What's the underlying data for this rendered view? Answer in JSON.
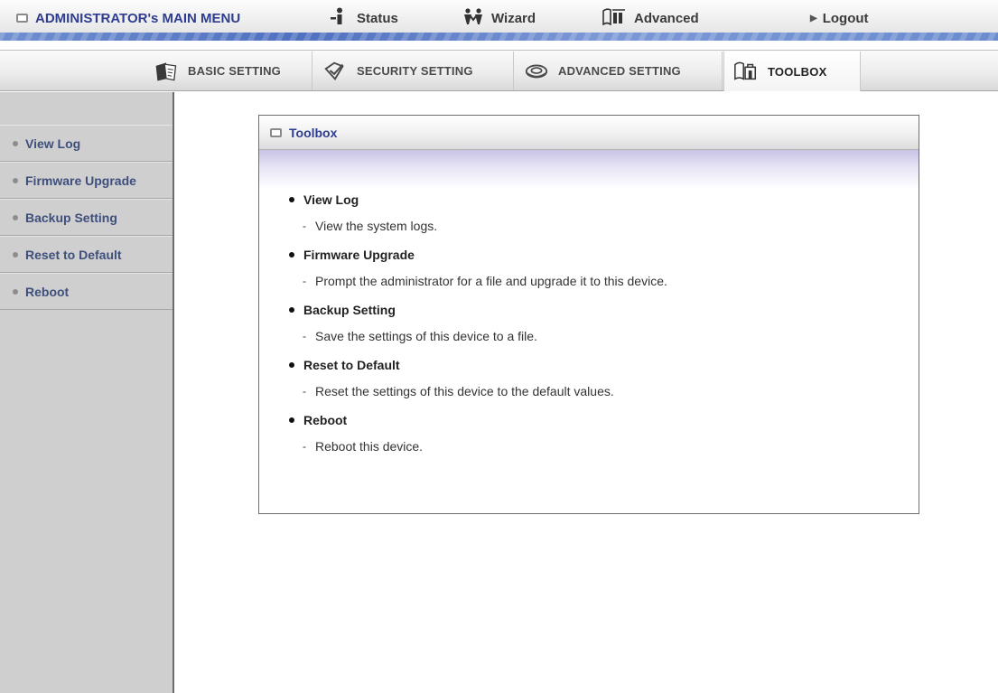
{
  "topbar": {
    "title": "ADMINISTRATOR's MAIN MENU",
    "nav": [
      {
        "label": "Status",
        "icon": "person-info-icon"
      },
      {
        "label": "Wizard",
        "icon": "wizard-people-icon"
      },
      {
        "label": "Advanced",
        "icon": "advanced-book-icon"
      },
      {
        "label": "Logout",
        "icon": "triangle-right-icon"
      }
    ]
  },
  "tabs": [
    {
      "label": "BASIC SETTING",
      "icon": "document-stack-icon"
    },
    {
      "label": "SECURITY SETTING",
      "icon": "shield-check-icon"
    },
    {
      "label": "ADVANCED SETTING",
      "icon": "gear-disc-icon"
    },
    {
      "label": "TOOLBOX",
      "icon": "toolbox-icon",
      "active": true
    }
  ],
  "sidebar": {
    "items": [
      {
        "label": "View Log"
      },
      {
        "label": "Firmware Upgrade"
      },
      {
        "label": "Backup Setting"
      },
      {
        "label": "Reset to Default"
      },
      {
        "label": "Reboot"
      }
    ]
  },
  "panel": {
    "title": "Toolbox",
    "items": [
      {
        "title": "View Log",
        "desc": "View the system logs."
      },
      {
        "title": "Firmware Upgrade",
        "desc": "Prompt the administrator for a file and upgrade it to this device."
      },
      {
        "title": "Backup Setting",
        "desc": "Save the settings of this device to a file."
      },
      {
        "title": "Reset to Default",
        "desc": "Reset the settings of this device to the default values."
      },
      {
        "title": "Reboot",
        "desc": "Reboot this device."
      }
    ]
  },
  "colors": {
    "accent": "#2e3d8f",
    "sidebar_text": "#3e4f7c",
    "stripe": "#4f70c0"
  }
}
